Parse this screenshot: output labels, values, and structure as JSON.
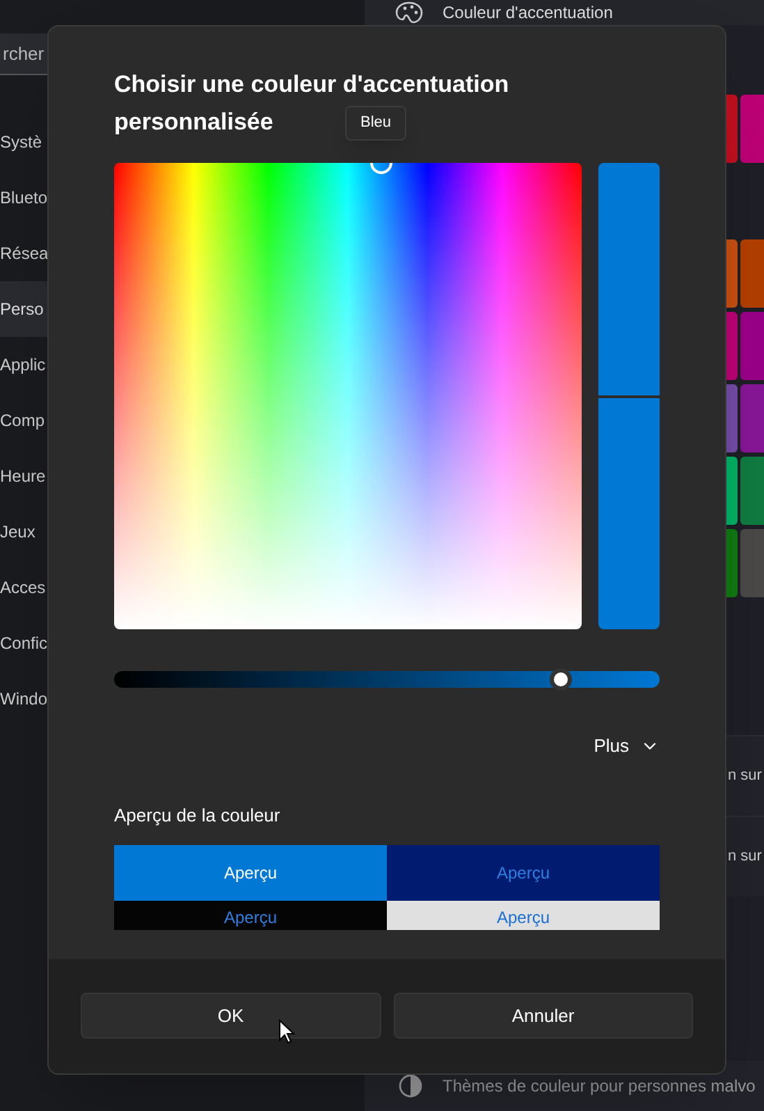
{
  "background": {
    "search": {
      "value": "rcher"
    },
    "sidebar": [
      {
        "label": "Systè",
        "selected": false
      },
      {
        "label": "Blueto",
        "selected": false
      },
      {
        "label": "Résea",
        "selected": false
      },
      {
        "label": "Perso",
        "selected": true
      },
      {
        "label": "Applic",
        "selected": false
      },
      {
        "label": "Comp",
        "selected": false
      },
      {
        "label": "Heure",
        "selected": false
      },
      {
        "label": "Jeux",
        "selected": false
      },
      {
        "label": "Acces",
        "selected": false
      },
      {
        "label": "Confic",
        "selected": false
      },
      {
        "label": "Windo",
        "selected": false
      }
    ],
    "header": "Couleur d'accentuation",
    "swatch_rows": [
      [
        {
          "color": "#c50f1f"
        },
        {
          "color": "#bf0077"
        }
      ],
      [],
      [
        {
          "color": "#ca5010"
        },
        {
          "color": "#b33f00"
        }
      ],
      [
        {
          "color": "#bf0077"
        },
        {
          "color": "#9a0089"
        }
      ],
      [
        {
          "color": "#744da9"
        },
        {
          "color": "#881798"
        }
      ],
      [
        {
          "color": "#00b366"
        },
        {
          "color": "#107c41"
        }
      ],
      [
        {
          "color": "#107c10"
        },
        {
          "color": "#4c4a48"
        }
      ]
    ],
    "rows": [
      "n sur",
      "n sur"
    ],
    "footer_text": "Thèmes de couleur pour personnes malvo"
  },
  "dialog": {
    "title_lines": [
      "Choisir une couleur d'accentuation",
      "personnalisée"
    ],
    "tooltip": "Bleu",
    "slider": {
      "level": 0.82
    },
    "more": "Plus",
    "preview_label": "Aperçu de la couleur",
    "previews": [
      "Aperçu",
      "Aperçu",
      "Aperçu",
      "Aperçu"
    ],
    "buttons": [
      "OK",
      "Annuler"
    ]
  }
}
